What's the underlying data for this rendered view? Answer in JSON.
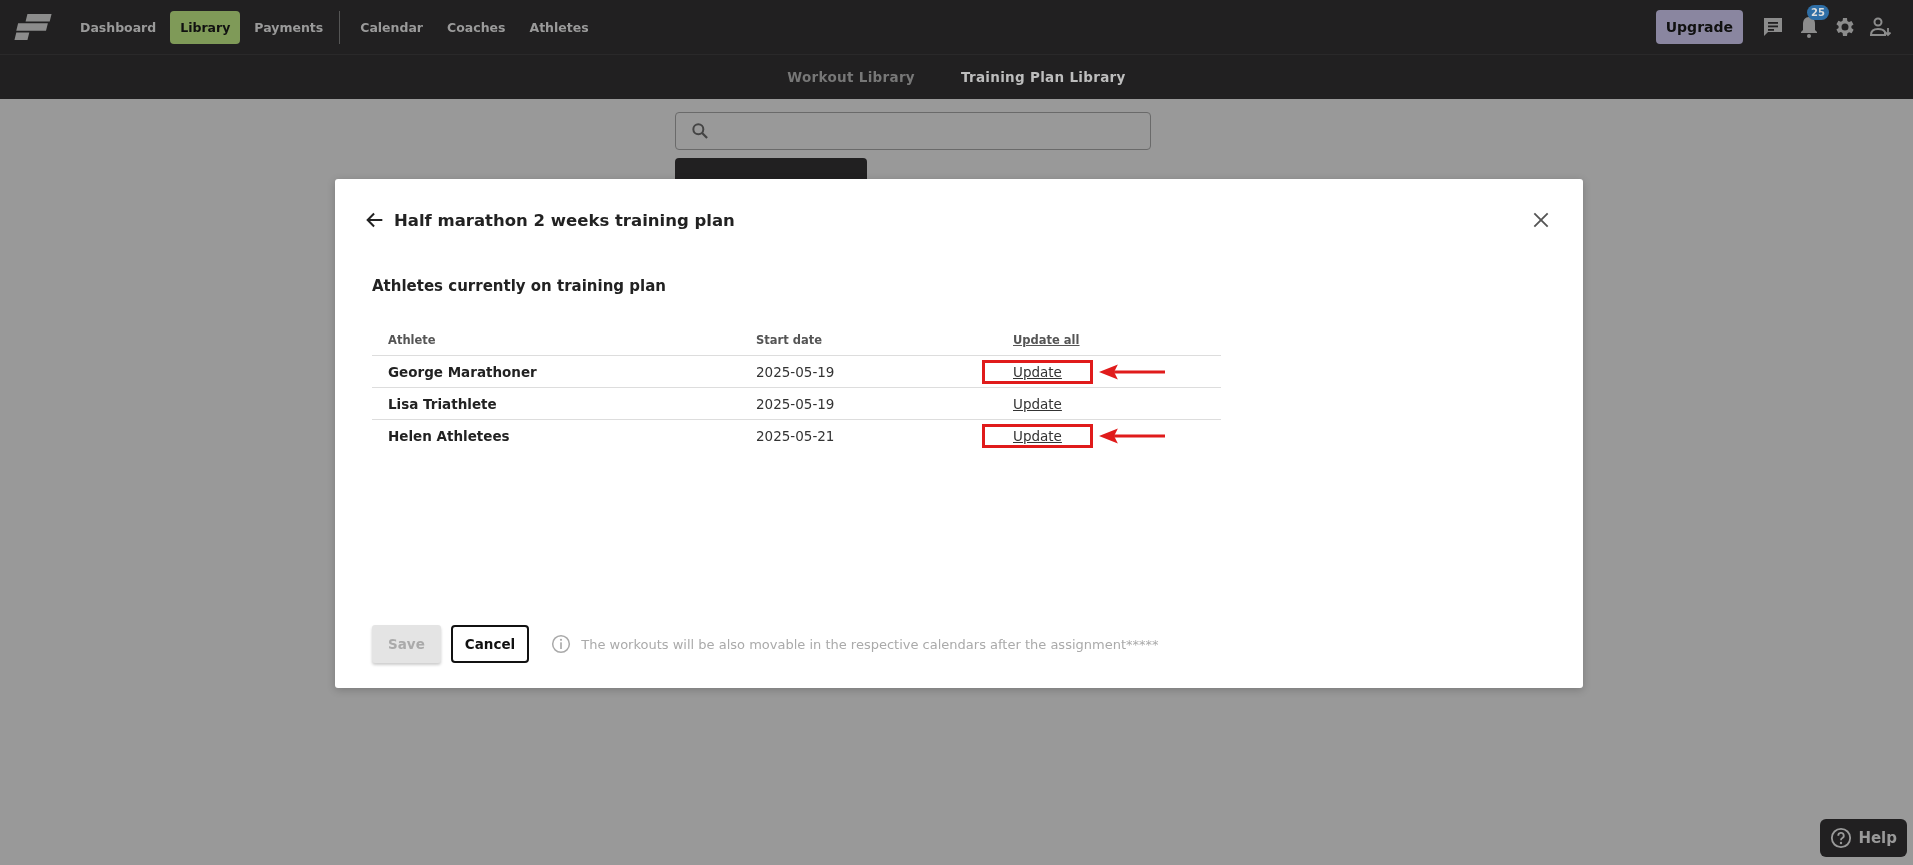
{
  "nav": {
    "items": [
      {
        "label": "Dashboard",
        "selected": false,
        "divider_after": false
      },
      {
        "label": "Library",
        "selected": true,
        "divider_after": false
      },
      {
        "label": "Payments",
        "selected": false,
        "divider_after": true
      },
      {
        "label": "Calendar",
        "selected": false,
        "divider_after": false
      },
      {
        "label": "Coaches",
        "selected": false,
        "divider_after": false
      },
      {
        "label": "Athletes",
        "selected": false,
        "divider_after": false
      }
    ],
    "upgrade": "Upgrade",
    "notification_count": "25"
  },
  "subnav": {
    "tabs": [
      {
        "label": "Workout Library",
        "selected": false
      },
      {
        "label": "Training Plan Library",
        "selected": true
      }
    ]
  },
  "modal": {
    "title": "Half marathon 2 weeks training plan",
    "section_title": "Athletes currently on training plan",
    "table": {
      "columns": [
        "Athlete",
        "Start date",
        "Update all"
      ],
      "rows": [
        {
          "athlete": "George Marathoner",
          "start_date": "2025-05-19",
          "action": "Update",
          "annotated": true
        },
        {
          "athlete": "Lisa Triathlete",
          "start_date": "2025-05-19",
          "action": "Update",
          "annotated": false
        },
        {
          "athlete": "Helen Athletees",
          "start_date": "2025-05-21",
          "action": "Update",
          "annotated": true
        }
      ]
    },
    "save": {
      "label": "Save",
      "disabled": true
    },
    "cancel": "Cancel",
    "note": "The workouts will be also movable in the respective calendars after the assignment*****"
  },
  "help": "Help"
}
